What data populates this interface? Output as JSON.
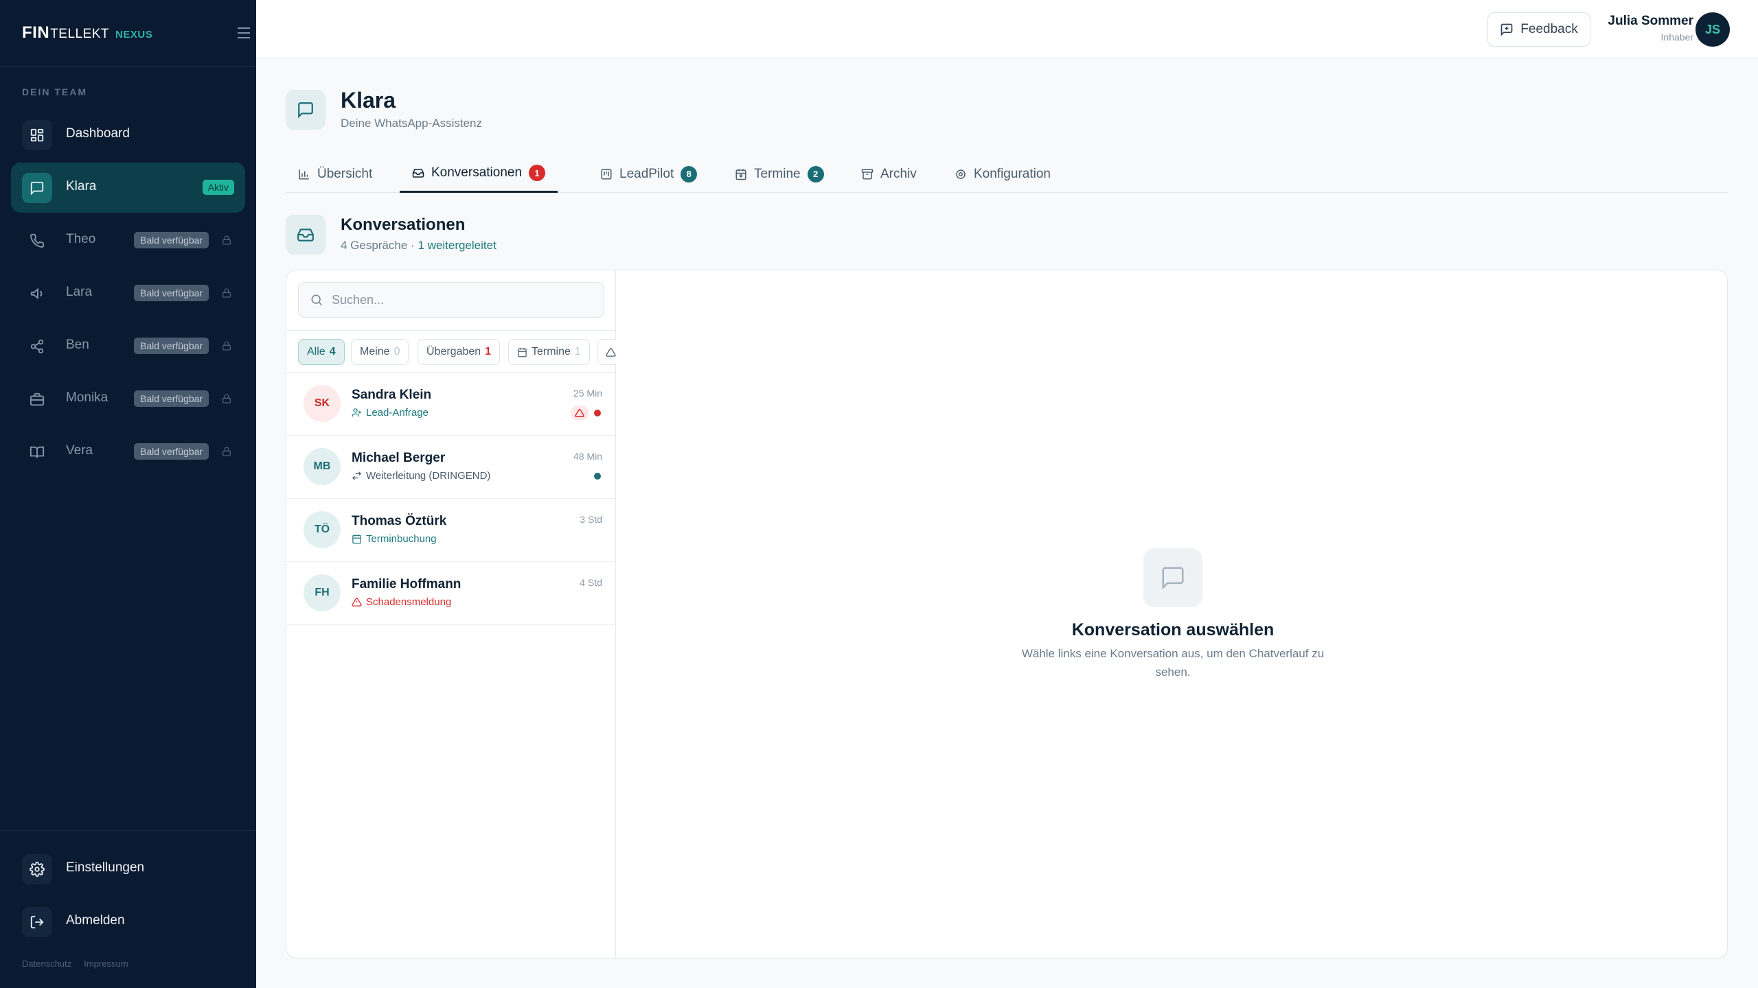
{
  "brand": {
    "fin": "FIN",
    "tellekt": "TELLEKT",
    "nexus": "NEXUS"
  },
  "sidebar": {
    "section_label": "DEIN TEAM",
    "items": [
      {
        "label": "Dashboard"
      },
      {
        "label": "Klara",
        "badge": "Aktiv"
      },
      {
        "label": "Theo",
        "badge": "Bald verfügbar"
      },
      {
        "label": "Lara",
        "badge": "Bald verfügbar"
      },
      {
        "label": "Ben",
        "badge": "Bald verfügbar"
      },
      {
        "label": "Monika",
        "badge": "Bald verfügbar"
      },
      {
        "label": "Vera",
        "badge": "Bald verfügbar"
      }
    ],
    "settings": "Einstellungen",
    "logout": "Abmelden",
    "footer": {
      "privacy": "Datenschutz",
      "imprint": "Impressum"
    }
  },
  "topbar": {
    "feedback": "Feedback",
    "user_name": "Julia Sommer",
    "user_role": "Inhaber",
    "avatar_initials": "JS"
  },
  "agent": {
    "name": "Klara",
    "subtitle": "Deine WhatsApp-Assistenz"
  },
  "tabs": [
    {
      "label": "Übersicht"
    },
    {
      "label": "Konversationen",
      "count": "1"
    },
    {
      "label": "LeadPilot",
      "count": "8"
    },
    {
      "label": "Termine",
      "count": "2"
    },
    {
      "label": "Archiv"
    },
    {
      "label": "Konfiguration"
    }
  ],
  "section": {
    "title": "Konversationen",
    "sub_count": "4 Gespräche · ",
    "sub_link": "1 weitergeleitet"
  },
  "search": {
    "placeholder": "Suchen..."
  },
  "filters": [
    {
      "label": "Alle",
      "count": "4"
    },
    {
      "label": "Meine",
      "count": "0"
    },
    {
      "label": "Übergaben",
      "count": "1"
    },
    {
      "label": "Termine",
      "count": "1"
    }
  ],
  "conversations": [
    {
      "initials": "SK",
      "name": "Sandra Klein",
      "tag": "Lead-Anfrage",
      "time": "25 Min"
    },
    {
      "initials": "MB",
      "name": "Michael Berger",
      "tag": "Weiterleitung (DRINGEND)",
      "time": "48 Min"
    },
    {
      "initials": "TÖ",
      "name": "Thomas Öztürk",
      "tag": "Terminbuchung",
      "time": "3 Std"
    },
    {
      "initials": "FH",
      "name": "Familie Hoffmann",
      "tag": "Schadensmeldung",
      "time": "4 Std"
    }
  ],
  "empty_state": {
    "title": "Konversation auswählen",
    "text": "Wähle links eine Konversation aus, um den Chatverlauf zu sehen."
  },
  "colors": {
    "sidebar_bg": "#0a1a30",
    "accent_teal": "#1c6e76",
    "active_badge": "#1fb59a",
    "alert_red": "#d92b2b"
  }
}
